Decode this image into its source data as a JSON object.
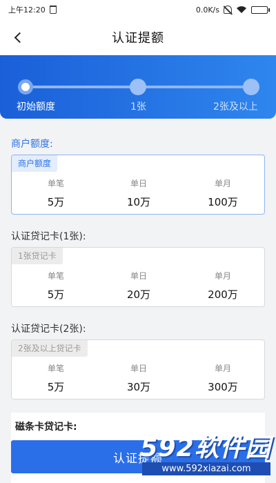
{
  "status_bar": {
    "time": "上午12:20",
    "net_speed": "0.0K/s",
    "icons": [
      "trash-icon",
      "bell-off-icon",
      "wifi-icon",
      "battery-icon"
    ]
  },
  "header": {
    "title": "认证提额"
  },
  "stepper": {
    "steps": [
      {
        "label": "初始额度",
        "active": true
      },
      {
        "label": "1张",
        "active": false
      },
      {
        "label": "2张及以上",
        "active": false
      }
    ]
  },
  "sections": [
    {
      "title": "商户额度:",
      "tag": "商户额度",
      "active": true,
      "limits": [
        {
          "label": "单笔",
          "value": "5万"
        },
        {
          "label": "单日",
          "value": "10万"
        },
        {
          "label": "单月",
          "value": "100万"
        }
      ]
    },
    {
      "title": "认证贷记卡(1张):",
      "tag": "1张贷记卡",
      "active": false,
      "limits": [
        {
          "label": "单笔",
          "value": "5万"
        },
        {
          "label": "单日",
          "value": "20万"
        },
        {
          "label": "单月",
          "value": "200万"
        }
      ]
    },
    {
      "title": "认证贷记卡(2张):",
      "tag": "2张及以上贷记卡",
      "active": false,
      "limits": [
        {
          "label": "单笔",
          "value": "5万"
        },
        {
          "label": "单日",
          "value": "30万"
        },
        {
          "label": "单月",
          "value": "300万"
        }
      ]
    }
  ],
  "bottom": {
    "title": "磁条卡贷记卡:",
    "button_label": "认证提额"
  },
  "watermark": {
    "main": "592软件园",
    "url": "www.592xiazai.com"
  },
  "colors": {
    "primary": "#2a6fe8",
    "stepper_start": "#1a5fd8",
    "stepper_end": "#2f86ee",
    "active_text": "#2a72e6"
  }
}
